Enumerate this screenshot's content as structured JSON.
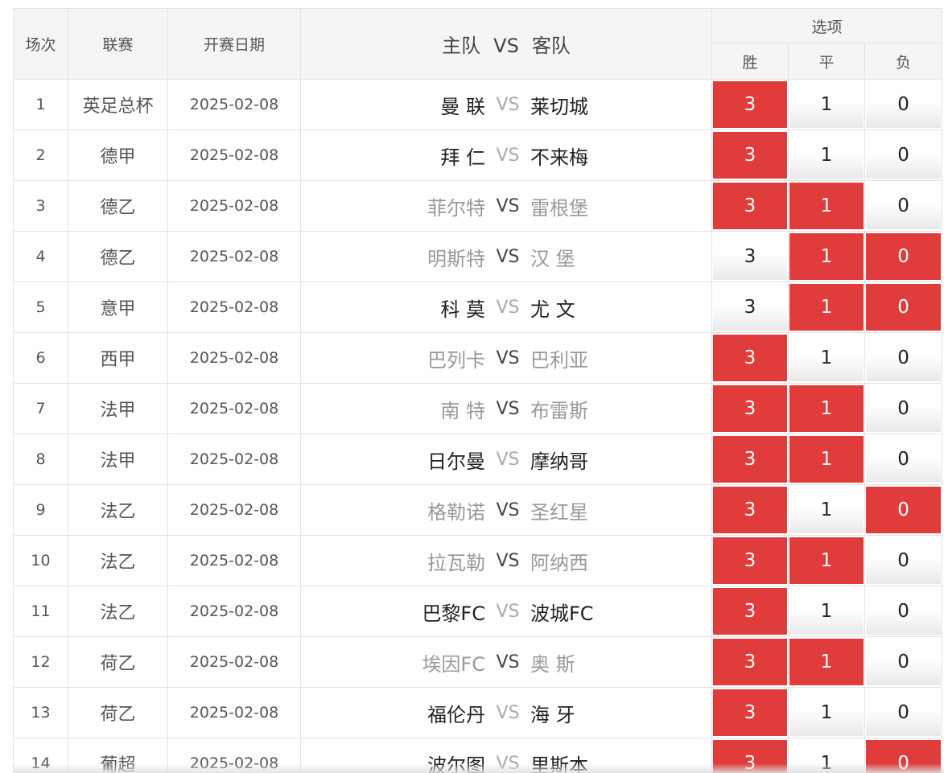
{
  "header": {
    "num": "场次",
    "league": "联赛",
    "date": "开赛日期",
    "home": "主队",
    "vs": "VS",
    "away": "客队",
    "options": "选项",
    "win": "胜",
    "draw": "平",
    "lose": "负"
  },
  "colors": {
    "selected": "#e03c3c",
    "team_dark": "#222222",
    "team_light": "#999999"
  },
  "rows": [
    {
      "num": "1",
      "league": "英足总杯",
      "date": "2025-02-08",
      "home": "曼 联",
      "vs": "VS",
      "away": "莱切城",
      "dim": false,
      "w": "3",
      "d": "1",
      "l": "0",
      "sel": [
        true,
        false,
        false
      ]
    },
    {
      "num": "2",
      "league": "德甲",
      "date": "2025-02-08",
      "home": "拜 仁",
      "vs": "VS",
      "away": "不来梅",
      "dim": false,
      "w": "3",
      "d": "1",
      "l": "0",
      "sel": [
        true,
        false,
        false
      ]
    },
    {
      "num": "3",
      "league": "德乙",
      "date": "2025-02-08",
      "home": "菲尔特",
      "vs": "VS",
      "away": "雷根堡",
      "dim": true,
      "w": "3",
      "d": "1",
      "l": "0",
      "sel": [
        true,
        true,
        false
      ]
    },
    {
      "num": "4",
      "league": "德乙",
      "date": "2025-02-08",
      "home": "明斯特",
      "vs": "VS",
      "away": "汉 堡",
      "dim": true,
      "w": "3",
      "d": "1",
      "l": "0",
      "sel": [
        false,
        true,
        true
      ]
    },
    {
      "num": "5",
      "league": "意甲",
      "date": "2025-02-08",
      "home": "科 莫",
      "vs": "VS",
      "away": "尤 文",
      "dim": false,
      "w": "3",
      "d": "1",
      "l": "0",
      "sel": [
        false,
        true,
        true
      ]
    },
    {
      "num": "6",
      "league": "西甲",
      "date": "2025-02-08",
      "home": "巴列卡",
      "vs": "VS",
      "away": "巴利亚",
      "dim": true,
      "w": "3",
      "d": "1",
      "l": "0",
      "sel": [
        true,
        false,
        false
      ]
    },
    {
      "num": "7",
      "league": "法甲",
      "date": "2025-02-08",
      "home": "南 特",
      "vs": "VS",
      "away": "布雷斯",
      "dim": true,
      "w": "3",
      "d": "1",
      "l": "0",
      "sel": [
        true,
        true,
        false
      ]
    },
    {
      "num": "8",
      "league": "法甲",
      "date": "2025-02-08",
      "home": "日尔曼",
      "vs": "VS",
      "away": "摩纳哥",
      "dim": false,
      "w": "3",
      "d": "1",
      "l": "0",
      "sel": [
        true,
        true,
        false
      ]
    },
    {
      "num": "9",
      "league": "法乙",
      "date": "2025-02-08",
      "home": "格勒诺",
      "vs": "VS",
      "away": "圣红星",
      "dim": true,
      "w": "3",
      "d": "1",
      "l": "0",
      "sel": [
        true,
        false,
        true
      ]
    },
    {
      "num": "10",
      "league": "法乙",
      "date": "2025-02-08",
      "home": "拉瓦勒",
      "vs": "VS",
      "away": "阿纳西",
      "dim": true,
      "w": "3",
      "d": "1",
      "l": "0",
      "sel": [
        true,
        true,
        false
      ]
    },
    {
      "num": "11",
      "league": "法乙",
      "date": "2025-02-08",
      "home": "巴黎FC",
      "vs": "VS",
      "away": "波城FC",
      "dim": false,
      "w": "3",
      "d": "1",
      "l": "0",
      "sel": [
        true,
        false,
        false
      ]
    },
    {
      "num": "12",
      "league": "荷乙",
      "date": "2025-02-08",
      "home": "埃因FC",
      "vs": "VS",
      "away": "奥 斯",
      "dim": true,
      "w": "3",
      "d": "1",
      "l": "0",
      "sel": [
        true,
        true,
        false
      ]
    },
    {
      "num": "13",
      "league": "荷乙",
      "date": "2025-02-08",
      "home": "福伦丹",
      "vs": "VS",
      "away": "海 牙",
      "dim": false,
      "w": "3",
      "d": "1",
      "l": "0",
      "sel": [
        true,
        false,
        false
      ]
    },
    {
      "num": "14",
      "league": "葡超",
      "date": "2025-02-08",
      "home": "波尔图",
      "vs": "VS",
      "away": "里斯本",
      "dim": false,
      "w": "3",
      "d": "1",
      "l": "0",
      "sel": [
        true,
        false,
        true
      ]
    }
  ]
}
